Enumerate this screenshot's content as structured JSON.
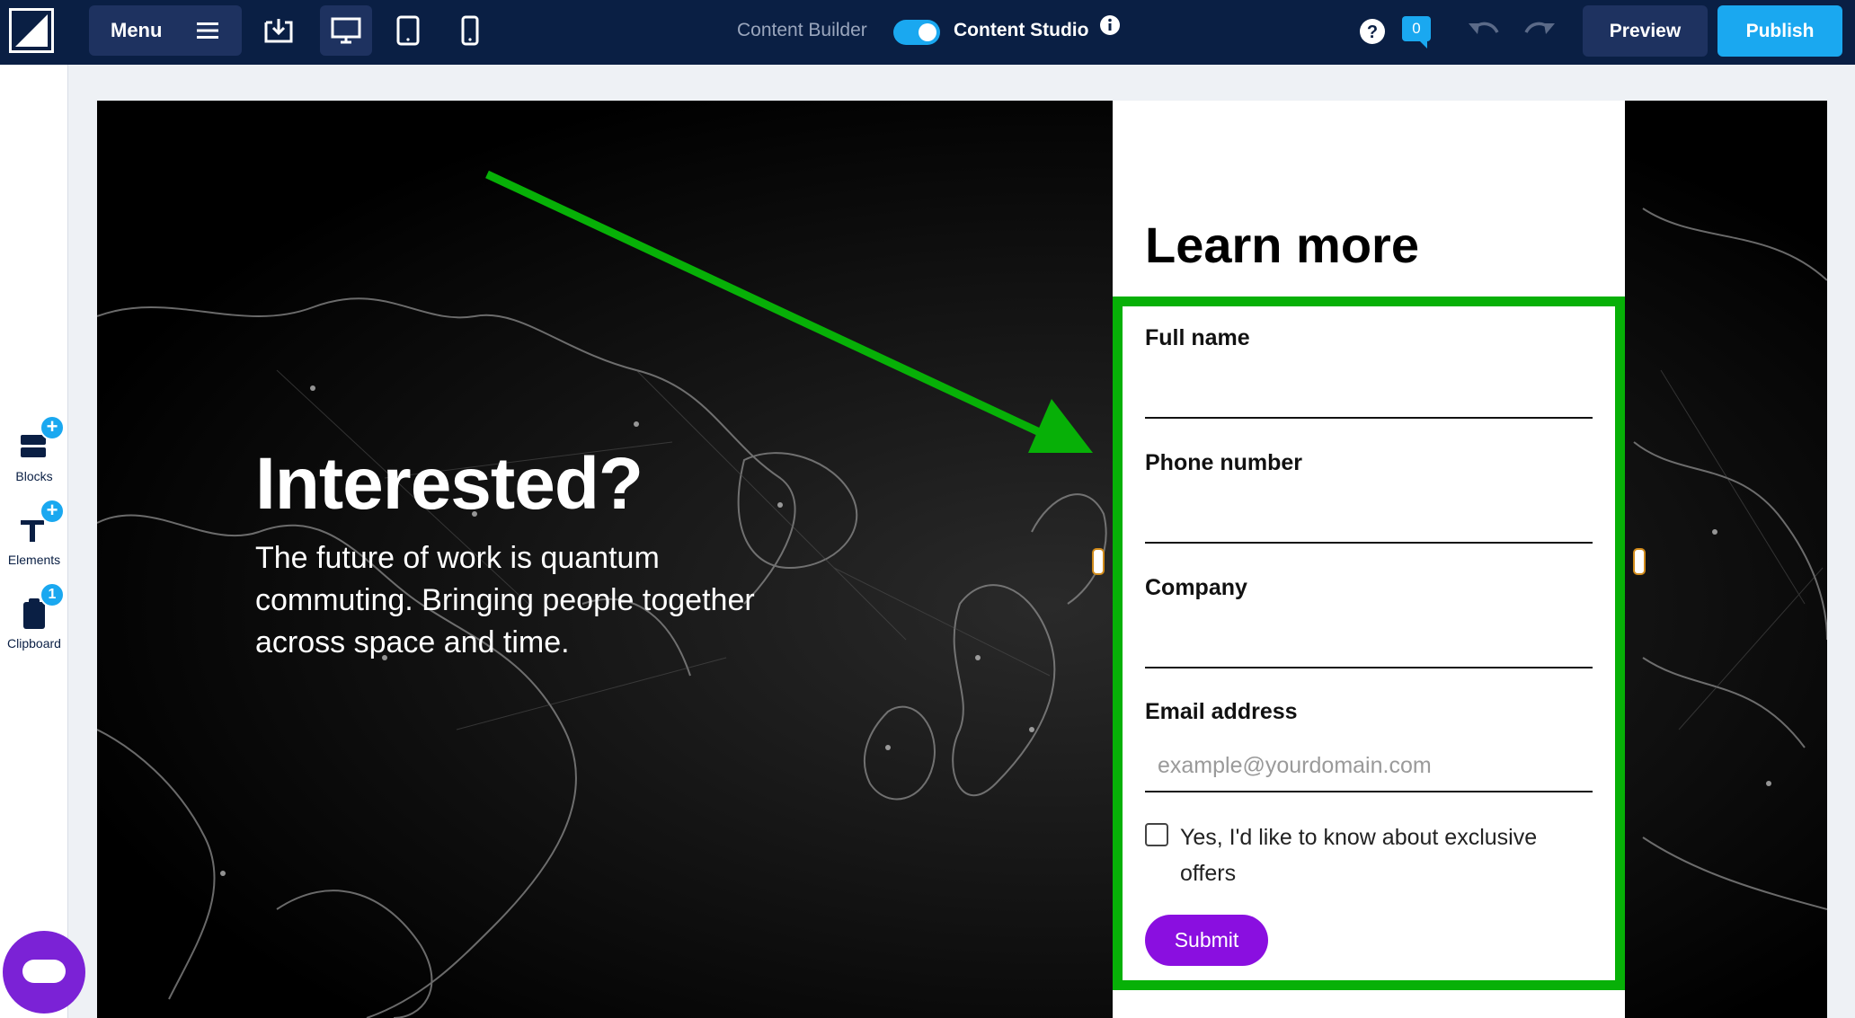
{
  "topbar": {
    "menu_label": "Menu",
    "content_builder_label": "Content Builder",
    "content_studio_label": "Content Studio",
    "notification_count": "0",
    "preview_label": "Preview",
    "publish_label": "Publish",
    "accent_color": "#1aa8f0",
    "bar_color": "#0a1f44",
    "toggle_on": true
  },
  "sidebar": {
    "items": [
      {
        "label": "Blocks",
        "icon": "blocks-icon",
        "badge": "+"
      },
      {
        "label": "Elements",
        "icon": "elements-icon",
        "badge": "+"
      },
      {
        "label": "Clipboard",
        "icon": "clipboard-icon",
        "badge": "1"
      }
    ]
  },
  "hero": {
    "title": "Interested?",
    "subtitle": "The future of work is quantum commuting. Bringing people together across space and time."
  },
  "form": {
    "title": "Learn more",
    "fields": [
      {
        "label": "Full name",
        "value": "",
        "placeholder": ""
      },
      {
        "label": "Phone number",
        "value": "",
        "placeholder": ""
      },
      {
        "label": "Company",
        "value": "",
        "placeholder": ""
      },
      {
        "label": "Email address",
        "value": "",
        "placeholder": "example@yourdomain.com"
      }
    ],
    "checkbox_label": "Yes, I'd like to know about exclusive offers",
    "checkbox_checked": false,
    "submit_label": "Submit",
    "highlight_color": "#07b007",
    "submit_color": "#8a0fe0"
  }
}
